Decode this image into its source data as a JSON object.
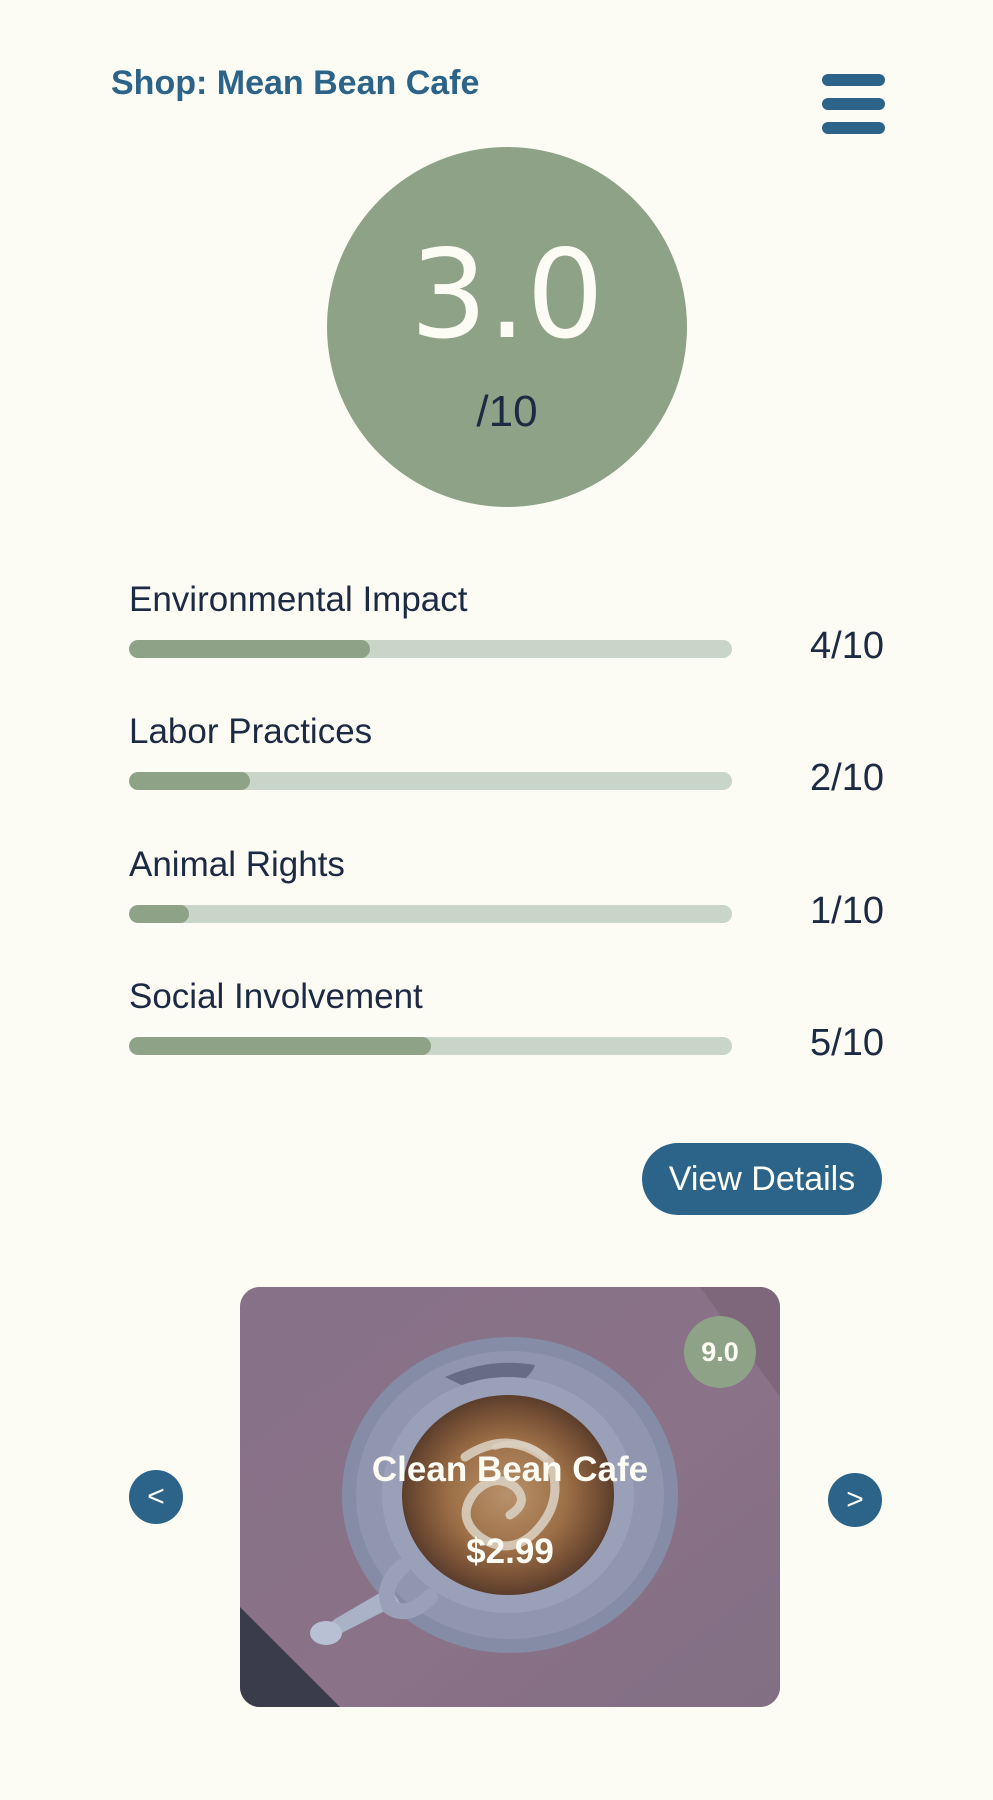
{
  "header": {
    "shop_title": "Shop: Mean Bean Cafe",
    "menu_icon": "hamburger-menu-icon"
  },
  "overall_score": {
    "value": "3.0",
    "max_label": "/10"
  },
  "metrics": [
    {
      "label": "Environmental Impact",
      "score_text": "4/10",
      "score": 4,
      "max": 10
    },
    {
      "label": "Labor Practices",
      "score_text": "2/10",
      "score": 2,
      "max": 10
    },
    {
      "label": "Animal Rights",
      "score_text": "1/10",
      "score": 1,
      "max": 10
    },
    {
      "label": "Social Involvement",
      "score_text": "5/10",
      "score": 5,
      "max": 10
    }
  ],
  "actions": {
    "view_details_label": "View Details"
  },
  "carousel": {
    "prev_label": "<",
    "next_label": ">",
    "card": {
      "name": "Clean Bean Cafe",
      "price": "$2.99",
      "rating": "9.0",
      "image": "latte-art-coffee-cup"
    }
  },
  "colors": {
    "background": "#fdfcf4",
    "primary": "#2c6389",
    "accent_green": "#8da287",
    "track_green": "#c9d5c7",
    "text_dark": "#1d2a44"
  }
}
